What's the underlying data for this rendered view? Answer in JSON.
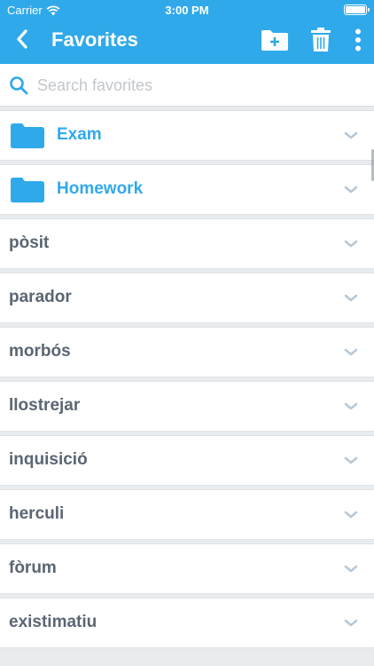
{
  "status_bar": {
    "carrier": "Carrier",
    "time": "3:00 PM"
  },
  "nav": {
    "title": "Favorites"
  },
  "search": {
    "placeholder": "Search favorites",
    "value": ""
  },
  "colors": {
    "accent": "#30a9ea",
    "folder": "#30a9ea",
    "word_text": "#5a6673",
    "chevron": "#b8c8d6"
  },
  "icons": {
    "back": "chevron-left-icon",
    "new_folder": "folder-plus-icon",
    "delete": "trash-icon",
    "more": "vertical-ellipsis-icon",
    "search": "search-icon",
    "folder": "folder-icon",
    "expand": "chevron-down-icon"
  },
  "folders": [
    {
      "label": "Exam"
    },
    {
      "label": "Homework"
    }
  ],
  "words": [
    {
      "label": "pòsit"
    },
    {
      "label": "parador"
    },
    {
      "label": "morbós"
    },
    {
      "label": "llostrejar"
    },
    {
      "label": "inquisició"
    },
    {
      "label": "herculi"
    },
    {
      "label": "fòrum"
    },
    {
      "label": "existimatiu"
    }
  ]
}
